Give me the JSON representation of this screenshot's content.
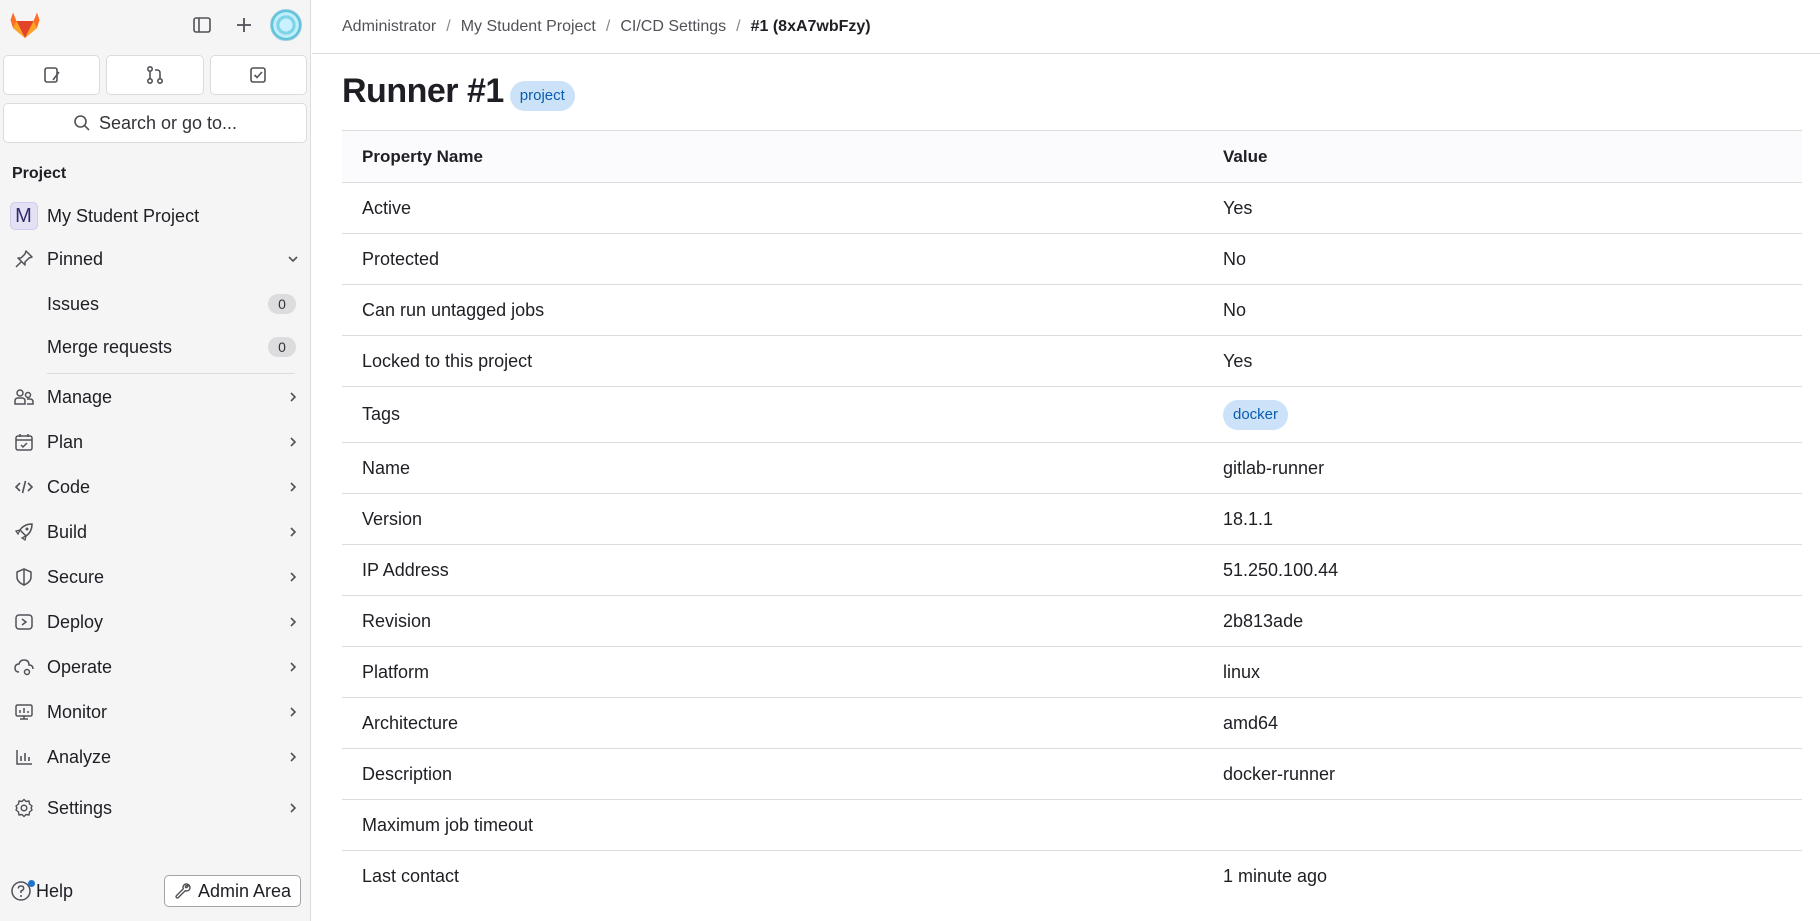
{
  "sidebar": {
    "search_label": "Search or go to...",
    "section_title": "Project",
    "project": {
      "initial": "M",
      "name": "My Student Project"
    },
    "pinned": {
      "label": "Pinned",
      "items": [
        {
          "label": "Issues",
          "count": "0"
        },
        {
          "label": "Merge requests",
          "count": "0"
        }
      ]
    },
    "nav": [
      {
        "label": "Manage",
        "icon": "users-icon"
      },
      {
        "label": "Plan",
        "icon": "calendar-icon"
      },
      {
        "label": "Code",
        "icon": "code-icon"
      },
      {
        "label": "Build",
        "icon": "rocket-icon"
      },
      {
        "label": "Secure",
        "icon": "shield-icon"
      },
      {
        "label": "Deploy",
        "icon": "deploy-icon"
      },
      {
        "label": "Operate",
        "icon": "cloud-gear-icon"
      },
      {
        "label": "Monitor",
        "icon": "monitor-icon"
      },
      {
        "label": "Analyze",
        "icon": "chart-icon"
      },
      {
        "label": "Settings",
        "icon": "gear-icon"
      }
    ],
    "help_label": "Help",
    "admin_label": "Admin Area"
  },
  "breadcrumb": {
    "items": [
      "Administrator",
      "My Student Project",
      "CI/CD Settings"
    ],
    "current": "#1 (8xA7wbFzy)"
  },
  "page": {
    "title": "Runner #1",
    "badge": "project"
  },
  "table": {
    "headers": [
      "Property Name",
      "Value"
    ],
    "rows": [
      {
        "name": "Active",
        "value": "Yes"
      },
      {
        "name": "Protected",
        "value": "No"
      },
      {
        "name": "Can run untagged jobs",
        "value": "No"
      },
      {
        "name": "Locked to this project",
        "value": "Yes"
      },
      {
        "name": "Tags",
        "value": "docker"
      },
      {
        "name": "Name",
        "value": "gitlab-runner"
      },
      {
        "name": "Version",
        "value": "18.1.1"
      },
      {
        "name": "IP Address",
        "value": "51.250.100.44"
      },
      {
        "name": "Revision",
        "value": "2b813ade"
      },
      {
        "name": "Platform",
        "value": "linux"
      },
      {
        "name": "Architecture",
        "value": "amd64"
      },
      {
        "name": "Description",
        "value": "docker-runner"
      },
      {
        "name": "Maximum job timeout",
        "value": ""
      },
      {
        "name": "Last contact",
        "value": "1 minute ago"
      }
    ]
  },
  "colors": {
    "badge_bg": "#cbe2f9",
    "badge_text": "#0b5cad",
    "logo_orange": "#e24329"
  }
}
